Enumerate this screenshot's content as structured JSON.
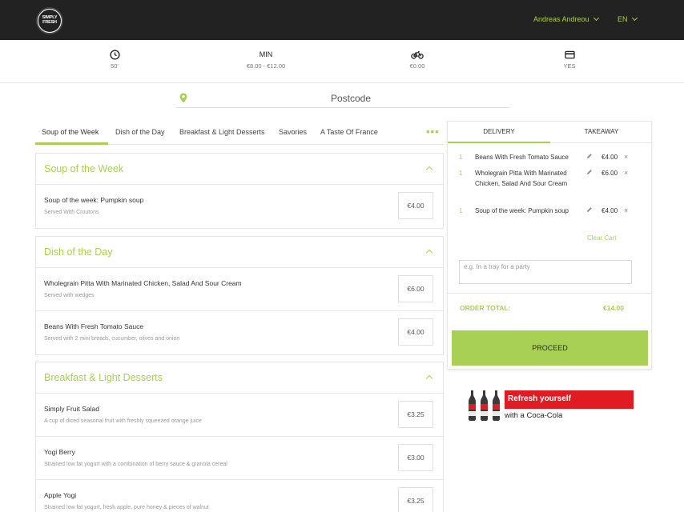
{
  "header": {
    "logo_text": "SIMPLY FRESH",
    "user_name": "Andreas Andreou",
    "language": "EN"
  },
  "info": [
    {
      "icon": "clock-icon",
      "label": "",
      "value": "50'"
    },
    {
      "icon": "",
      "label": "MIN",
      "value": "€8.00 - €12.00"
    },
    {
      "icon": "bike-icon",
      "label": "",
      "value": "€0.00"
    },
    {
      "icon": "card-icon",
      "label": "",
      "value": "YES"
    }
  ],
  "postcode": {
    "placeholder": "Postcode"
  },
  "tabs": [
    "Soup of the Week",
    "Dish of the Day",
    "Breakfast & Light Desserts",
    "Savories",
    "A Taste Of France"
  ],
  "tabs_more": "•••",
  "sections": [
    {
      "title": "Soup of the Week",
      "items": [
        {
          "name": "Soup of the week: Pumpkin soup",
          "desc": "Served With Croutons",
          "price": "€4.00"
        }
      ]
    },
    {
      "title": "Dish of the Day",
      "items": [
        {
          "name": "Wholegrain Pitta With Marinated Chicken, Salad And Sour Cream",
          "desc": "Served with wedges",
          "price": "€6.00"
        },
        {
          "name": "Beans With Fresh Tomato Sauce",
          "desc": "Served with 2 mini breads, cucumber, olives and onion",
          "price": "€4.00"
        }
      ]
    },
    {
      "title": "Breakfast & Light Desserts",
      "items": [
        {
          "name": "Simply Fruit Salad",
          "desc": "A cup of diced seasonal fruit with freshly squeezed orange juice",
          "price": "€3.25"
        },
        {
          "name": "Yogi Berry",
          "desc": "Strained low fat yogurt with a combination of berry sauce & granola cereal",
          "price": "€3.00"
        },
        {
          "name": "Apple Yogi",
          "desc": "Strained low fat yogurt, fresh apple, pure honey & pieces of walnut",
          "price": "€3.25"
        }
      ]
    }
  ],
  "cart": {
    "tab_delivery": "DELIVERY",
    "tab_takeaway": "TAKEAWAY",
    "items": [
      {
        "qty": "1",
        "name": "Beans With Fresh Tomato Sauce",
        "price": "€4.00"
      },
      {
        "qty": "1",
        "name": "Wholegrain Pitta With Marinated Chicken, Salad And Sour Cream",
        "price": "€6.00"
      },
      {
        "qty": "1",
        "name": "Soup of the week: Pumpkin soup",
        "price": "€4.00"
      }
    ],
    "remove_symbol": "×",
    "clear_label": "Clear Cart",
    "note_placeholder": "e.g. In a tray for a party",
    "total_label": "ORDER TOTAL:",
    "total_value": "€14.00",
    "proceed_label": "PROCEED"
  },
  "ad": {
    "headline": "Refresh yourself",
    "subline": "with a Coca-Cola",
    "brand_color": "#e11b22"
  },
  "colors": {
    "accent": "#a8d054",
    "header_bg": "#222222"
  }
}
